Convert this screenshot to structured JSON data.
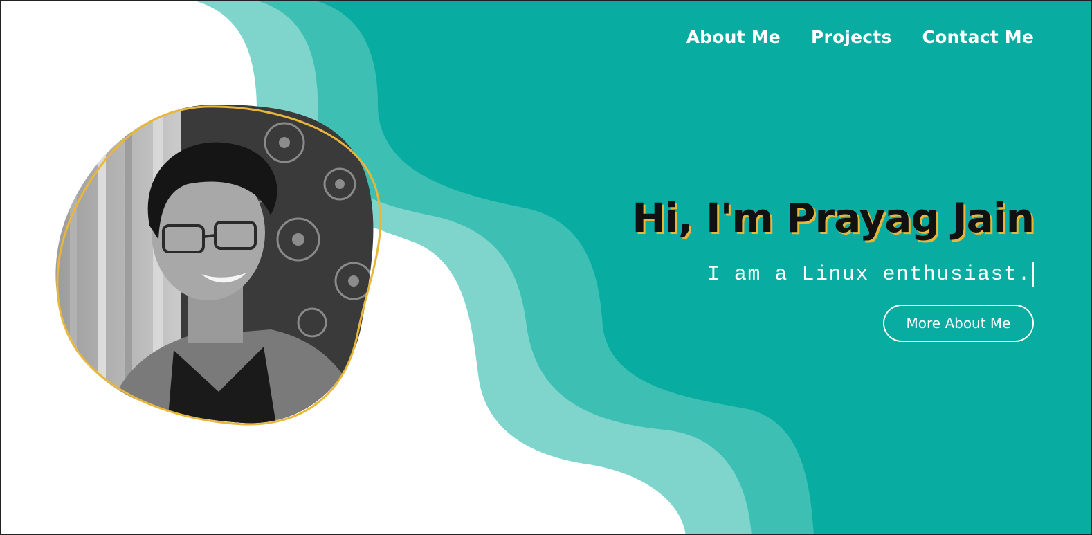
{
  "nav": {
    "items": [
      {
        "label": "About Me"
      },
      {
        "label": "Projects"
      },
      {
        "label": "Contact Me"
      }
    ]
  },
  "hero": {
    "title": "Hi, I'm Prayag Jain",
    "subtitle": "I am a Linux enthusiast.",
    "cta_label": "More About Me"
  },
  "colors": {
    "background": "#ffffff",
    "wave_light": "#7fd5cc",
    "wave_mid": "#3dbfb3",
    "wave_dark": "#08aca1",
    "accent": "#e8b73a",
    "title_text": "#111111"
  }
}
